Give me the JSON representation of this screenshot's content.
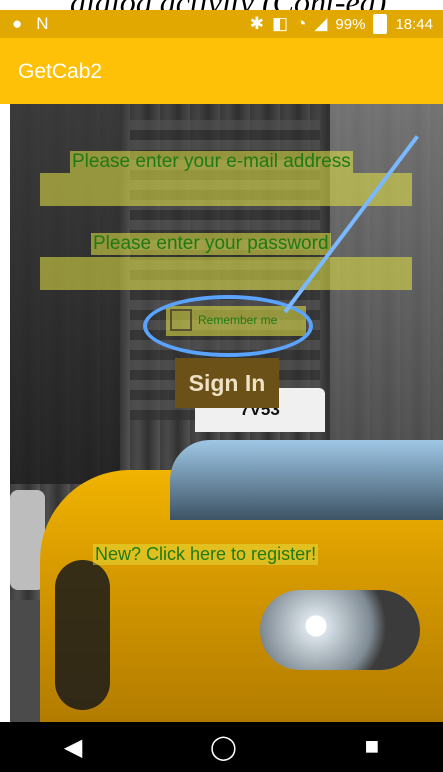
{
  "caption": {
    "text": "dialog activity (Cont-ed)"
  },
  "status_bar": {
    "icons": [
      "spotify-icon",
      "n-icon",
      "bluetooth-icon",
      "nfc-icon",
      "wifi-icon",
      "signal-icon",
      "battery-icon"
    ],
    "battery_percent": "99%",
    "time": "18:44"
  },
  "app_bar": {
    "title": "GetCab2"
  },
  "form": {
    "email_text": "Please enter your e-mail address",
    "password_text": "Please enter your password",
    "remember_label": "Remember me",
    "remember_checked": false,
    "signin_label": "Sign In",
    "register_text": "New? Click here to register!"
  },
  "scene": {
    "taxi_sign": "7V53"
  },
  "nav_bar": {
    "back_icon": "◀",
    "home_icon": "◯",
    "recents_icon": "■"
  },
  "colors": {
    "status_bar": "#e0a800",
    "app_bar": "#ffc107",
    "highlight": "#5aa3ff",
    "text_green": "#1f7a14",
    "signin_bg": "#6b5118"
  }
}
